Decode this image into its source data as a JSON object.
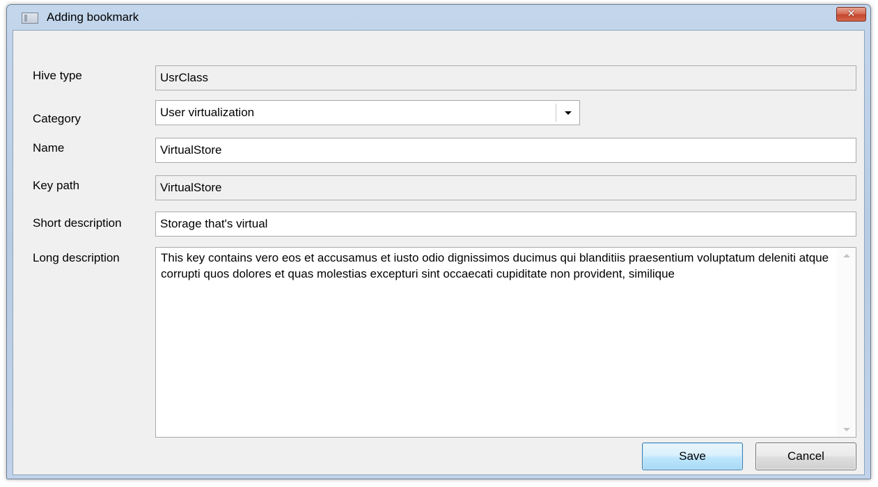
{
  "window": {
    "title": "Adding bookmark",
    "close_glyph": "✕"
  },
  "form": {
    "hive_type": {
      "label": "Hive type",
      "value": "UsrClass"
    },
    "category": {
      "label": "Category",
      "value": "User virtualization"
    },
    "name": {
      "label": "Name",
      "value": "VirtualStore"
    },
    "key_path": {
      "label": "Key path",
      "value": "VirtualStore"
    },
    "short_description": {
      "label": "Short description",
      "value": "Storage that's virtual"
    },
    "long_description": {
      "label": "Long description",
      "value": "This key contains vero eos et accusamus et iusto odio dignissimos ducimus qui blanditiis praesentium voluptatum deleniti atque corrupti quos dolores et quas molestias excepturi sint occaecati cupiditate non provident, similique"
    }
  },
  "buttons": {
    "save_label": "Save",
    "cancel_label": "Cancel"
  },
  "icons": {
    "window": "window-icon",
    "close": "close-icon",
    "dropdown": "chevron-down-icon",
    "scroll_up": "scroll-up-icon",
    "scroll_down": "scroll-down-icon"
  },
  "colors": {
    "title_bar": "#c3d6ec",
    "close_button": "#c4472c",
    "default_button": "#bee6fd",
    "client_bg": "#f0f0f0"
  }
}
